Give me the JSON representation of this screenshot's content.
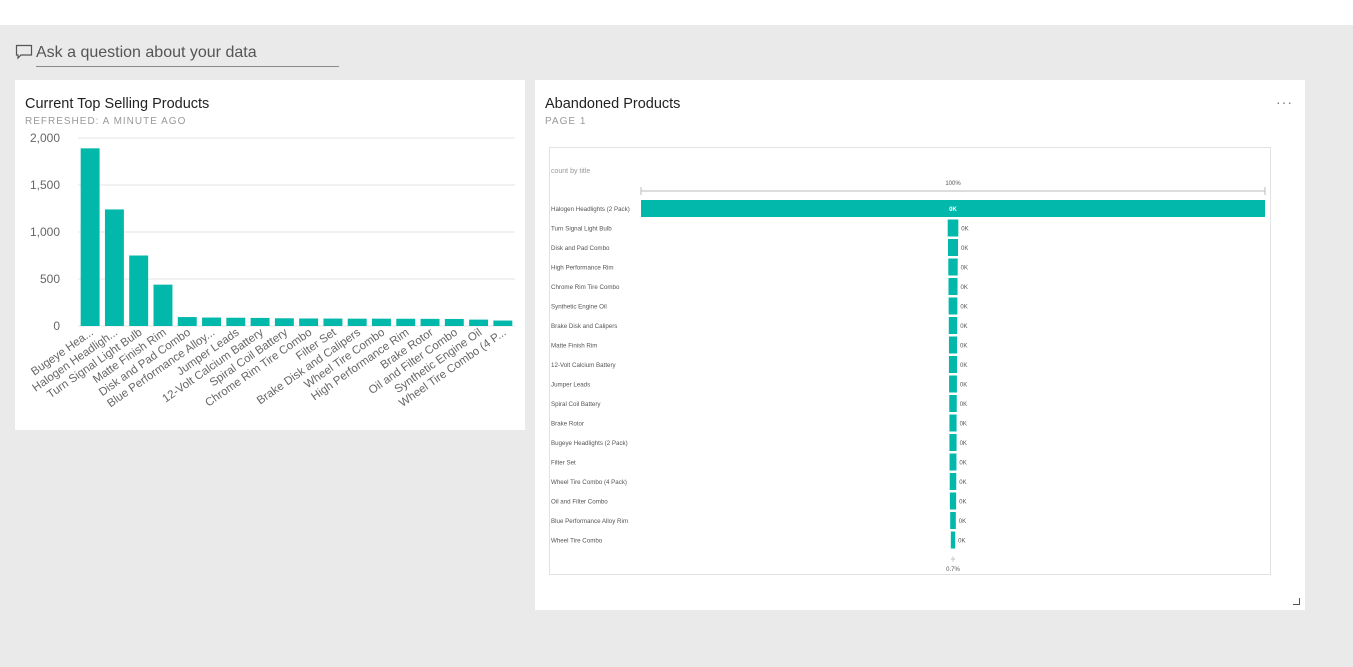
{
  "qa": {
    "placeholder": "Ask a question about your data",
    "icon": "speech-bubble-icon"
  },
  "tile1": {
    "title": "Current Top Selling Products",
    "subtitle": "REFRESHED: A MINUTE AGO"
  },
  "tile2": {
    "title": "Abandoned Products",
    "subtitle": "PAGE 1",
    "more_label": "···"
  },
  "colors": {
    "accent": "#01b8aa",
    "grid": "#e6e6e6",
    "axis_text": "#666666"
  },
  "chart_data": [
    {
      "type": "bar",
      "title": "Current Top Selling Products",
      "categories": [
        "Bugeye Hea...",
        "Halogen Headligh...",
        "Turn Signal Light Bulb",
        "Matte Finish Rim",
        "Disk and Pad Combo",
        "Blue Performance Alloy...",
        "Jumper Leads",
        "12-Volt Calcium Battery",
        "Spiral Coil Battery",
        "Chrome Rim Tire Combo",
        "Filter Set",
        "Brake Disk and Calipers",
        "Wheel Tire Combo",
        "High Performance Rim",
        "Brake Rotor",
        "Oil and Filter Combo",
        "Synthetic Engine Oil",
        "Wheel Tire Combo (4 P..."
      ],
      "values": [
        1890,
        1240,
        750,
        440,
        95,
        90,
        88,
        86,
        82,
        80,
        79,
        78,
        78,
        77,
        76,
        75,
        68,
        58
      ],
      "yticks": [
        "0",
        "500",
        "1,000",
        "1,500",
        "2,000"
      ],
      "ylim": [
        0,
        2000
      ],
      "grid": true
    },
    {
      "type": "funnel",
      "title": "Abandoned Products",
      "axis_label": "count by title",
      "top_pct_label": "100%",
      "bottom_pct_label": "0.7%",
      "categories": [
        "Halogen Headlights (2 Pack)",
        "Turn Signal Light Bulb",
        "Disk and Pad Combo",
        "High Performance Rim",
        "Chrome Rim Tire Combo",
        "Synthetic Engine Oil",
        "Brake Disk and Calipers",
        "Matte Finish Rim",
        "12-Volt Calcium Battery",
        "Jumper Leads",
        "Spiral Coil Battery",
        "Brake Rotor",
        "Bugeye Headlights (2 Pack)",
        "Filter Set",
        "Wheel Tire Combo (4 Pack)",
        "Oil and Filter Combo",
        "Blue Performance Alloy Rim",
        "Wheel Tire Combo"
      ],
      "values": [
        100,
        1.7,
        1.6,
        1.5,
        1.45,
        1.4,
        1.35,
        1.3,
        1.3,
        1.25,
        1.2,
        1.15,
        1.15,
        1.1,
        1.05,
        1.0,
        0.9,
        0.7
      ],
      "data_labels": [
        "0K",
        "0K",
        "0K",
        "0K",
        "0K",
        "0K",
        "0K",
        "0K",
        "0K",
        "0K",
        "0K",
        "0K",
        "0K",
        "0K",
        "0K",
        "0K",
        "0K",
        "0K"
      ]
    }
  ]
}
